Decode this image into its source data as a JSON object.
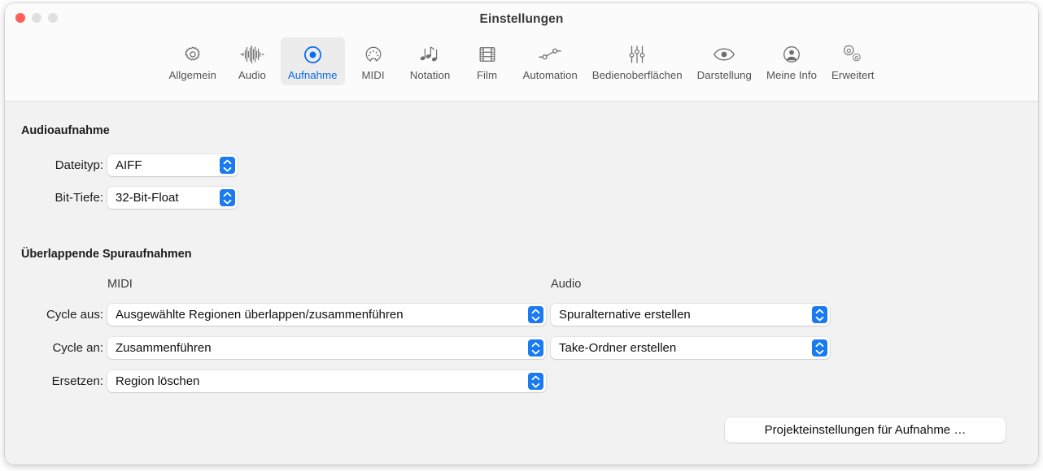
{
  "window": {
    "title": "Einstellungen",
    "controls": [
      {
        "name": "close",
        "color": "#ff5f57"
      },
      {
        "name": "minimize",
        "color": "#e0e0e0"
      },
      {
        "name": "maximize",
        "color": "#e0e0e0"
      }
    ]
  },
  "toolbar": {
    "accent_color": "#0a6cf0",
    "selected_tab": "Aufnahme",
    "tabs": [
      {
        "id": "allgemein",
        "label": "Allgemein",
        "icon": "gear-icon",
        "selected": false
      },
      {
        "id": "audio",
        "label": "Audio",
        "icon": "waveform-icon",
        "selected": false
      },
      {
        "id": "aufnahme",
        "label": "Aufnahme",
        "icon": "record-icon",
        "selected": true
      },
      {
        "id": "midi",
        "label": "MIDI",
        "icon": "midi-plug-icon",
        "selected": false
      },
      {
        "id": "notation",
        "label": "Notation",
        "icon": "music-notes-icon",
        "selected": false
      },
      {
        "id": "film",
        "label": "Film",
        "icon": "film-strip-icon",
        "selected": false
      },
      {
        "id": "automation",
        "label": "Automation",
        "icon": "automation-icon",
        "selected": false
      },
      {
        "id": "bedienoberflaechen",
        "label": "Bedienoberflächen",
        "icon": "sliders-icon",
        "selected": false
      },
      {
        "id": "darstellung",
        "label": "Darstellung",
        "icon": "eye-icon",
        "selected": false
      },
      {
        "id": "meineinfo",
        "label": "Meine Info",
        "icon": "person-icon",
        "selected": false
      },
      {
        "id": "erweitert",
        "label": "Erweitert",
        "icon": "gears-icon",
        "selected": false
      }
    ]
  },
  "audio_recording": {
    "section_title": "Audioaufnahme",
    "file_type": {
      "label": "Dateityp:",
      "value": "AIFF"
    },
    "bit_depth": {
      "label": "Bit-Tiefe:",
      "value": "32-Bit-Float"
    }
  },
  "overlapping": {
    "section_title": "Überlappende Spuraufnahmen",
    "column_midi": "MIDI",
    "column_audio": "Audio",
    "rows": [
      {
        "label": "Cycle aus:",
        "midi_value": "Ausgewählte Regionen überlappen/zusammenführen",
        "audio_value": "Spuralternative erstellen"
      },
      {
        "label": "Cycle an:",
        "midi_value": "Zusammenführen",
        "audio_value": "Take-Ordner erstellen"
      },
      {
        "label": "Ersetzen:",
        "midi_value": "Region löschen",
        "audio_value": null
      }
    ]
  },
  "footer": {
    "project_settings_button": "Projekteinstellungen für Aufnahme …"
  }
}
